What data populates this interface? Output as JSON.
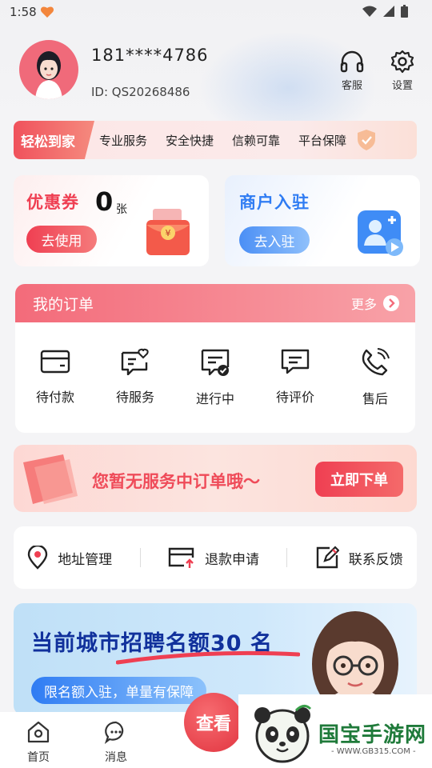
{
  "status_bar": {
    "time": "1:58"
  },
  "profile": {
    "phone": "181****4786",
    "user_id": "ID: QS20268486"
  },
  "header_actions": {
    "service_label": "客服",
    "settings_label": "设置"
  },
  "feature_strip": {
    "tag": "轻松到家",
    "items": [
      "专业服务",
      "安全快捷",
      "信赖可靠",
      "平台保障"
    ]
  },
  "coupon_card": {
    "title": "优惠券",
    "count": "0",
    "unit": "张",
    "button": "去使用"
  },
  "merchant_card": {
    "title": "商户入驻",
    "button": "去入驻"
  },
  "orders": {
    "title": "我的订单",
    "more": "更多",
    "items": [
      {
        "label": "待付款",
        "icon": "wallet-icon"
      },
      {
        "label": "待服务",
        "icon": "heart-chat-icon"
      },
      {
        "label": "进行中",
        "icon": "message-check-icon"
      },
      {
        "label": "待评价",
        "icon": "comment-icon"
      },
      {
        "label": "售后",
        "icon": "phone-icon"
      }
    ]
  },
  "empty_banner": {
    "text": "您暂无服务中订单哦～",
    "button": "立即下单"
  },
  "tools": [
    {
      "label": "地址管理",
      "icon": "location-icon"
    },
    {
      "label": "退款申请",
      "icon": "refund-icon"
    },
    {
      "label": "联系反馈",
      "icon": "edit-icon"
    }
  ],
  "recruit": {
    "headline": "当前城市招聘名额30 名",
    "sub": "限名额入驻，单量有保障"
  },
  "tabbar": {
    "home": "首页",
    "messages": "消息",
    "center_button": "查看"
  },
  "watermark": {
    "brand": "国宝手游网",
    "url": "- WWW.GB315.COM -"
  },
  "colors": {
    "accent_red": "#ef4b59",
    "accent_blue": "#2f7cf3",
    "recruit_navy": "#11319c"
  }
}
